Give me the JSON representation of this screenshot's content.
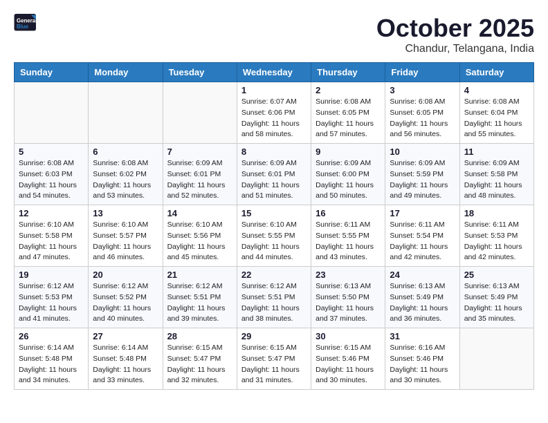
{
  "header": {
    "logo_line1": "General",
    "logo_line2": "Blue",
    "title": "October 2025",
    "subtitle": "Chandur, Telangana, India"
  },
  "weekdays": [
    "Sunday",
    "Monday",
    "Tuesday",
    "Wednesday",
    "Thursday",
    "Friday",
    "Saturday"
  ],
  "weeks": [
    [
      {
        "day": "",
        "info": ""
      },
      {
        "day": "",
        "info": ""
      },
      {
        "day": "",
        "info": ""
      },
      {
        "day": "1",
        "info": "Sunrise: 6:07 AM\nSunset: 6:06 PM\nDaylight: 11 hours\nand 58 minutes."
      },
      {
        "day": "2",
        "info": "Sunrise: 6:08 AM\nSunset: 6:05 PM\nDaylight: 11 hours\nand 57 minutes."
      },
      {
        "day": "3",
        "info": "Sunrise: 6:08 AM\nSunset: 6:05 PM\nDaylight: 11 hours\nand 56 minutes."
      },
      {
        "day": "4",
        "info": "Sunrise: 6:08 AM\nSunset: 6:04 PM\nDaylight: 11 hours\nand 55 minutes."
      }
    ],
    [
      {
        "day": "5",
        "info": "Sunrise: 6:08 AM\nSunset: 6:03 PM\nDaylight: 11 hours\nand 54 minutes."
      },
      {
        "day": "6",
        "info": "Sunrise: 6:08 AM\nSunset: 6:02 PM\nDaylight: 11 hours\nand 53 minutes."
      },
      {
        "day": "7",
        "info": "Sunrise: 6:09 AM\nSunset: 6:01 PM\nDaylight: 11 hours\nand 52 minutes."
      },
      {
        "day": "8",
        "info": "Sunrise: 6:09 AM\nSunset: 6:01 PM\nDaylight: 11 hours\nand 51 minutes."
      },
      {
        "day": "9",
        "info": "Sunrise: 6:09 AM\nSunset: 6:00 PM\nDaylight: 11 hours\nand 50 minutes."
      },
      {
        "day": "10",
        "info": "Sunrise: 6:09 AM\nSunset: 5:59 PM\nDaylight: 11 hours\nand 49 minutes."
      },
      {
        "day": "11",
        "info": "Sunrise: 6:09 AM\nSunset: 5:58 PM\nDaylight: 11 hours\nand 48 minutes."
      }
    ],
    [
      {
        "day": "12",
        "info": "Sunrise: 6:10 AM\nSunset: 5:58 PM\nDaylight: 11 hours\nand 47 minutes."
      },
      {
        "day": "13",
        "info": "Sunrise: 6:10 AM\nSunset: 5:57 PM\nDaylight: 11 hours\nand 46 minutes."
      },
      {
        "day": "14",
        "info": "Sunrise: 6:10 AM\nSunset: 5:56 PM\nDaylight: 11 hours\nand 45 minutes."
      },
      {
        "day": "15",
        "info": "Sunrise: 6:10 AM\nSunset: 5:55 PM\nDaylight: 11 hours\nand 44 minutes."
      },
      {
        "day": "16",
        "info": "Sunrise: 6:11 AM\nSunset: 5:55 PM\nDaylight: 11 hours\nand 43 minutes."
      },
      {
        "day": "17",
        "info": "Sunrise: 6:11 AM\nSunset: 5:54 PM\nDaylight: 11 hours\nand 42 minutes."
      },
      {
        "day": "18",
        "info": "Sunrise: 6:11 AM\nSunset: 5:53 PM\nDaylight: 11 hours\nand 42 minutes."
      }
    ],
    [
      {
        "day": "19",
        "info": "Sunrise: 6:12 AM\nSunset: 5:53 PM\nDaylight: 11 hours\nand 41 minutes."
      },
      {
        "day": "20",
        "info": "Sunrise: 6:12 AM\nSunset: 5:52 PM\nDaylight: 11 hours\nand 40 minutes."
      },
      {
        "day": "21",
        "info": "Sunrise: 6:12 AM\nSunset: 5:51 PM\nDaylight: 11 hours\nand 39 minutes."
      },
      {
        "day": "22",
        "info": "Sunrise: 6:12 AM\nSunset: 5:51 PM\nDaylight: 11 hours\nand 38 minutes."
      },
      {
        "day": "23",
        "info": "Sunrise: 6:13 AM\nSunset: 5:50 PM\nDaylight: 11 hours\nand 37 minutes."
      },
      {
        "day": "24",
        "info": "Sunrise: 6:13 AM\nSunset: 5:49 PM\nDaylight: 11 hours\nand 36 minutes."
      },
      {
        "day": "25",
        "info": "Sunrise: 6:13 AM\nSunset: 5:49 PM\nDaylight: 11 hours\nand 35 minutes."
      }
    ],
    [
      {
        "day": "26",
        "info": "Sunrise: 6:14 AM\nSunset: 5:48 PM\nDaylight: 11 hours\nand 34 minutes."
      },
      {
        "day": "27",
        "info": "Sunrise: 6:14 AM\nSunset: 5:48 PM\nDaylight: 11 hours\nand 33 minutes."
      },
      {
        "day": "28",
        "info": "Sunrise: 6:15 AM\nSunset: 5:47 PM\nDaylight: 11 hours\nand 32 minutes."
      },
      {
        "day": "29",
        "info": "Sunrise: 6:15 AM\nSunset: 5:47 PM\nDaylight: 11 hours\nand 31 minutes."
      },
      {
        "day": "30",
        "info": "Sunrise: 6:15 AM\nSunset: 5:46 PM\nDaylight: 11 hours\nand 30 minutes."
      },
      {
        "day": "31",
        "info": "Sunrise: 6:16 AM\nSunset: 5:46 PM\nDaylight: 11 hours\nand 30 minutes."
      },
      {
        "day": "",
        "info": ""
      }
    ]
  ]
}
